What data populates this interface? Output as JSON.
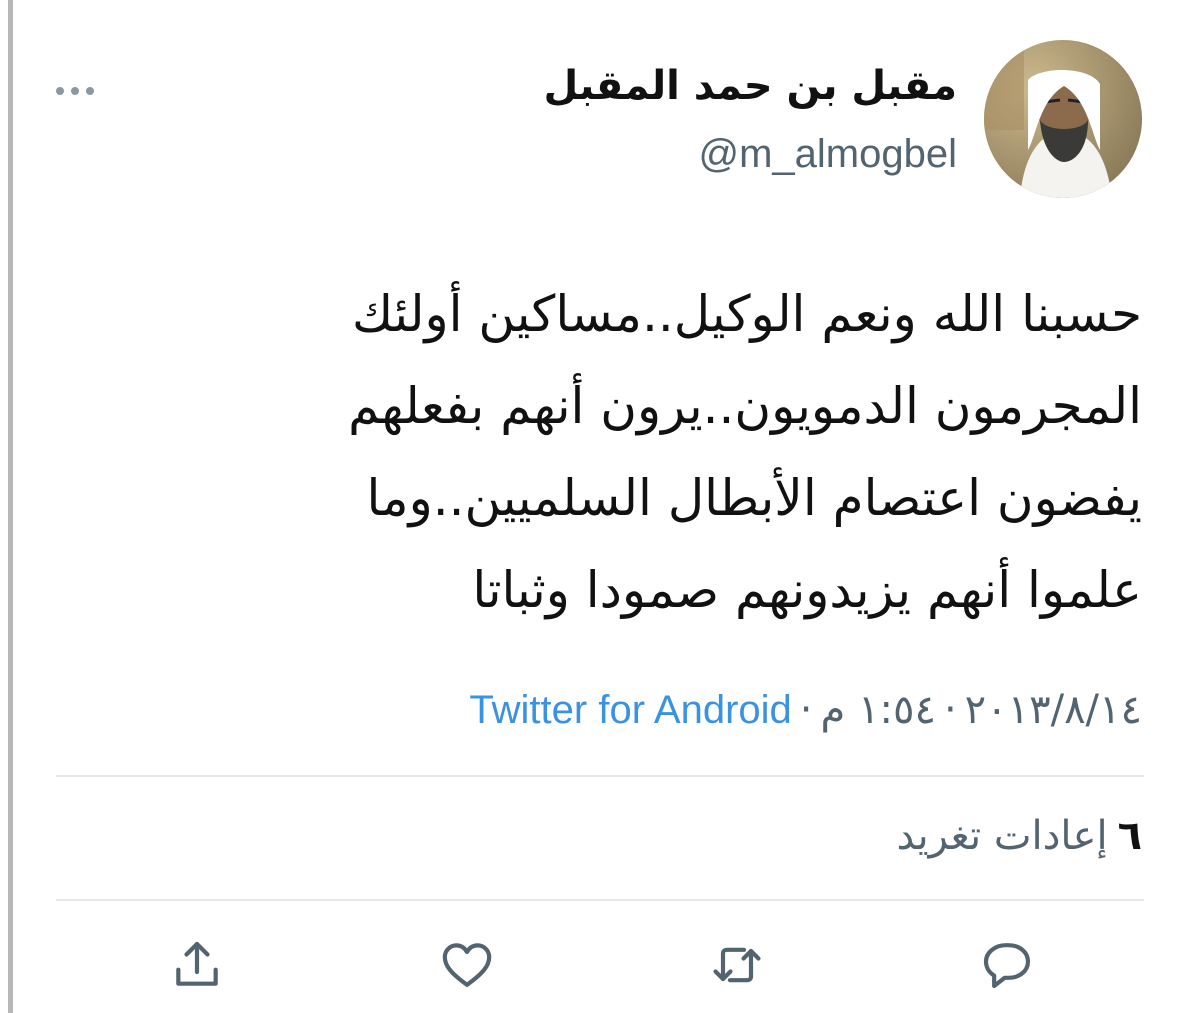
{
  "tweet": {
    "author": {
      "display_name": "مقبل بن حمد المقبل",
      "handle": "@m_almogbel"
    },
    "text_lines": [
      "حسبنا الله ونعم الوكيل..مساكين أولئك",
      "المجرمون الدمويون..يرون أنهم بفعلهم",
      "يفضون اعتصام الأبطال السلميين..وما",
      "علموا أنهم يزيدونهم صمودا وثباتا"
    ],
    "date": "٢٠١٣/٨/١٤",
    "time": "١:٥٤ م",
    "separator": "·",
    "source": "Twitter for Android",
    "retweet_count": "٦",
    "retweet_label": "إعادات تغريد"
  },
  "icons": {
    "more": "more-horizontal-icon",
    "reply": "reply-icon",
    "retweet": "retweet-icon",
    "like": "heart-icon",
    "share": "share-icon"
  },
  "colors": {
    "text": "#111111",
    "secondary": "#536471",
    "link": "#3a93e1",
    "icon": "#536471",
    "divider": "#e6e9eb"
  }
}
